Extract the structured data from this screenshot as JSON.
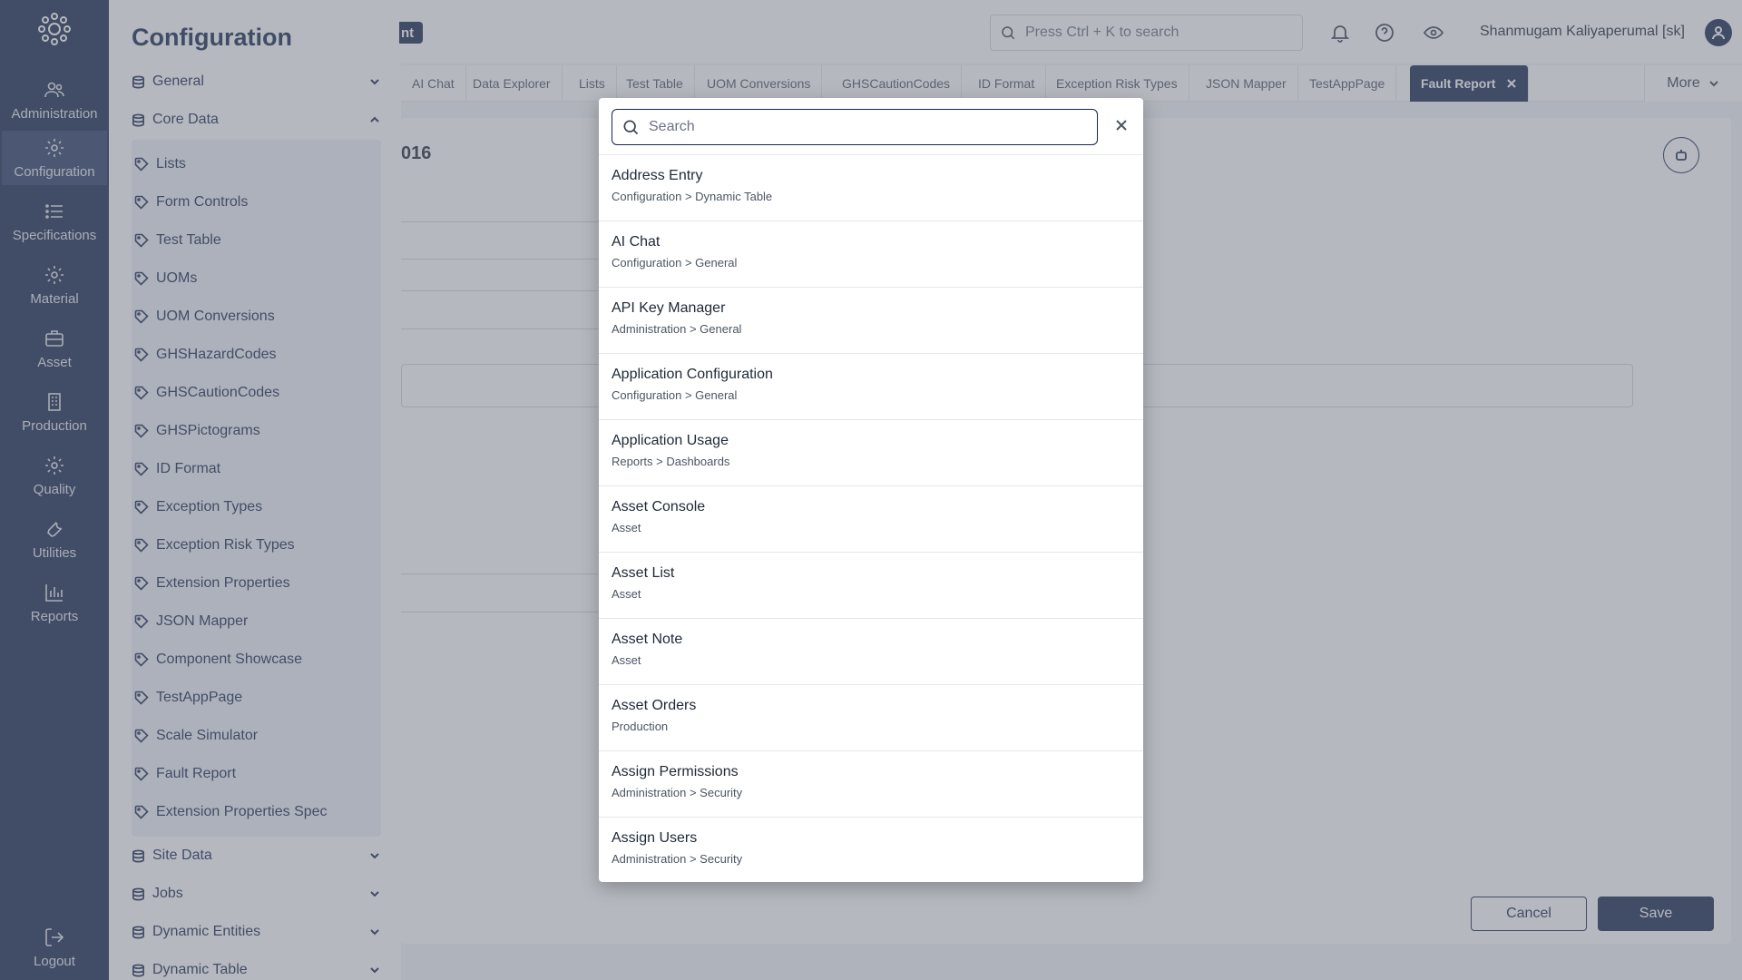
{
  "rail": {
    "items": [
      {
        "label": "Administration",
        "icon": "users-icon"
      },
      {
        "label": "Configuration",
        "icon": "gear-icon",
        "active": true
      },
      {
        "label": "Specifications",
        "icon": "list-icon"
      },
      {
        "label": "Material",
        "icon": "gear-icon"
      },
      {
        "label": "Asset",
        "icon": "briefcase-icon"
      },
      {
        "label": "Production",
        "icon": "building-icon"
      },
      {
        "label": "Quality",
        "icon": "gear-icon"
      },
      {
        "label": "Utilities",
        "icon": "wrench-icon"
      },
      {
        "label": "Reports",
        "icon": "bar-chart-icon"
      }
    ],
    "logout": "Logout"
  },
  "config": {
    "title": "Configuration",
    "groups": {
      "general": "General",
      "core_data": "Core Data",
      "site_data": "Site Data",
      "jobs": "Jobs",
      "dynamic_entities": "Dynamic Entities",
      "dynamic_table": "Dynamic Table"
    },
    "core_items": [
      "Lists",
      "Form Controls",
      "Test Table",
      "UOMs",
      "UOM Conversions",
      "GHSHazardCodes",
      "GHSCautionCodes",
      "GHSPictograms",
      "ID Format",
      "Exception Types",
      "Exception Risk Types",
      "Extension Properties",
      "JSON Mapper",
      "Component Showcase",
      "TestAppPage",
      "Scale Simulator",
      "Fault Report",
      "Extension Properties Spec"
    ]
  },
  "header": {
    "pill_text": "nt",
    "search_placeholder": "Press Ctrl + K to search",
    "user_name": "Shanmugam Kaliyaperumal [sk]"
  },
  "tabs": [
    "AI Chat",
    "Data Explorer",
    "Lists",
    "Test Table",
    "UOM Conversions",
    "GHSCautionCodes",
    "ID Format",
    "Exception Risk Types",
    "JSON Mapper",
    "TestAppPage",
    "Fault Report"
  ],
  "active_tab": "Fault Report",
  "more_label": "More",
  "card": {
    "title_fragment": "016",
    "cancel": "Cancel",
    "save": "Save"
  },
  "modal": {
    "search_placeholder": "Search",
    "results": [
      {
        "title": "Address Entry",
        "path": "Configuration > Dynamic Table"
      },
      {
        "title": "AI Chat",
        "path": "Configuration > General"
      },
      {
        "title": "API Key Manager",
        "path": "Administration > General"
      },
      {
        "title": "Application Configuration",
        "path": "Configuration > General"
      },
      {
        "title": "Application Usage",
        "path": "Reports > Dashboards"
      },
      {
        "title": "Asset Console",
        "path": "Asset"
      },
      {
        "title": "Asset List",
        "path": "Asset"
      },
      {
        "title": "Asset Note",
        "path": "Asset"
      },
      {
        "title": "Asset Orders",
        "path": "Production"
      },
      {
        "title": "Assign Permissions",
        "path": "Administration > Security"
      },
      {
        "title": "Assign Users",
        "path": "Administration > Security"
      }
    ]
  },
  "colors": {
    "brand": "#16264d",
    "overlay": "rgba(107,114,128,0.5)"
  }
}
